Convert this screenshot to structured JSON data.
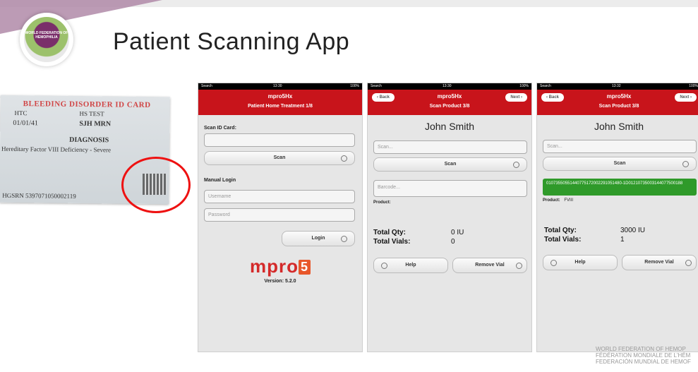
{
  "slide": {
    "title": "Patient Scanning App"
  },
  "logo": {
    "text": "WORLD FEDERATION OF HEMOPHILIA"
  },
  "card": {
    "title": "BLEEDING DISORDER ID CARD",
    "htc": "HTC",
    "hs_test": "HS TEST",
    "date": "01/01/41",
    "mrn": "SJH MRN",
    "diagnosis_heading": "DIAGNOSIS",
    "diagnosis": "Hereditary Factor VIII Deficiency - Severe",
    "hgsrn": "HGSRN  5397071050002119"
  },
  "screen1": {
    "status_left": "Search",
    "status_time": "13:30",
    "status_right": "100%",
    "app_title": "mpro5Hx",
    "subtitle": "Patient Home Treatment 1/8",
    "scan_id_label": "Scan ID Card:",
    "scan_button": "Scan",
    "manual_login_label": "Manual Login",
    "username_placeholder": "Username",
    "password_placeholder": "Password",
    "login_button": "Login",
    "brand_m": "mpro",
    "brand_5": "5",
    "version": "Version: 5.2.0"
  },
  "screen2": {
    "status_left": "Search",
    "status_time": "13:30",
    "status_right": "100%",
    "back": "Back",
    "app_title": "mpro5Hx",
    "next": "Next",
    "subtitle": "Scan Product 3/8",
    "patient_name": "John Smith",
    "scan_placeholder": "Scan...",
    "scan_button": "Scan",
    "barcode_placeholder": "Barcode...",
    "product_label": "Product:",
    "product_value": "",
    "total_qty_label": "Total Qty:",
    "total_qty_value": "0 IU",
    "total_vials_label": "Total Vials:",
    "total_vials_value": "0",
    "help_button": "Help",
    "remove_button": "Remove Vial"
  },
  "screen3": {
    "status_left": "Search",
    "status_time": "13:32",
    "status_right": "100%",
    "back": "Back",
    "app_title": "mpro5Hx",
    "next": "Next",
    "subtitle": "Scan Product 3/8",
    "patient_name": "John Smith",
    "scan_placeholder": "Scan...",
    "scan_button": "Scan",
    "barcode_value": "01073550551440775172002291051480-1D01210735003144077500188",
    "product_label": "Product:",
    "product_value": "FVIII",
    "total_qty_label": "Total Qty:",
    "total_qty_value": "3000 IU",
    "total_vials_label": "Total Vials:",
    "total_vials_value": "1",
    "help_button": "Help",
    "remove_button": "Remove Vial"
  },
  "footer": {
    "line1": "WORLD FEDERATION OF HEMOP",
    "line2": "FÉDÉRATION MONDIALE DE L'HÉM",
    "line3": "FEDERACIÓN MUNDIAL DE HEMOF"
  },
  "colors": {
    "nav_red": "#c8141b",
    "barcode_green": "#2f9a2a",
    "highlight_circle": "#e11111"
  }
}
